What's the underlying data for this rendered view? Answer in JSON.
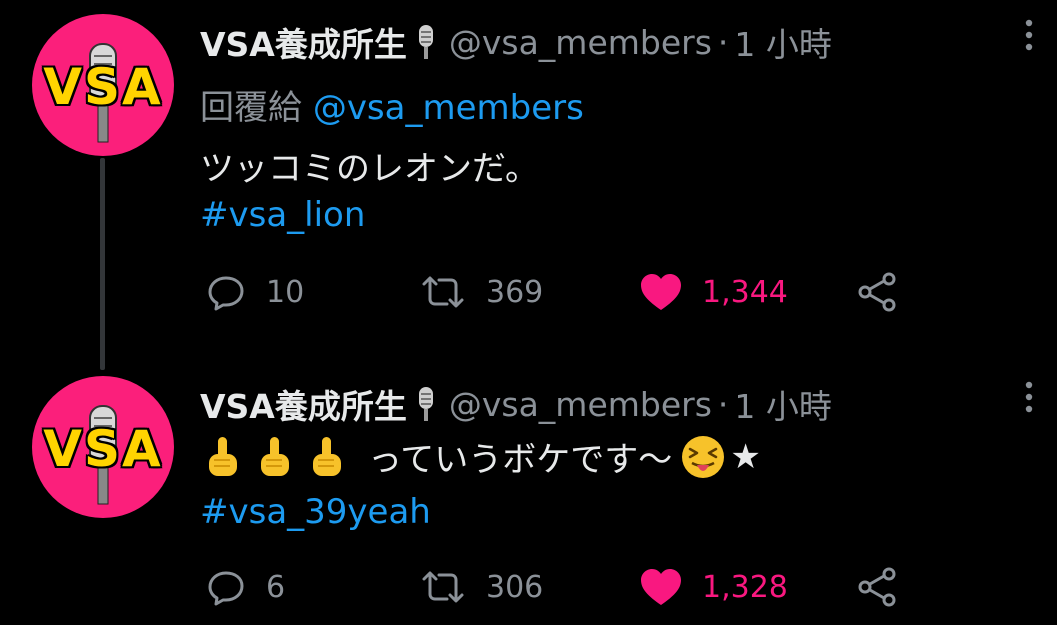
{
  "tweets": [
    {
      "avatar_text": "VSA",
      "name": "VSA養成所生",
      "handle": "@vsa_members",
      "dot": "·",
      "time": "1 小時",
      "reply_prefix": "回覆給",
      "reply_to": "@vsa_members",
      "text": "ツッコミのレオンだ。",
      "hashtag": "#vsa_lion",
      "replies": "10",
      "retweets": "369",
      "likes": "1,344"
    },
    {
      "avatar_text": "VSA",
      "name": "VSA養成所生",
      "handle": "@vsa_members",
      "dot": "·",
      "time": "1 小時",
      "text": "っていうボケです～",
      "star": "★",
      "hashtag": "#vsa_39yeah",
      "replies": "6",
      "retweets": "306",
      "likes": "1,328"
    }
  ],
  "colors": {
    "background": "#000000",
    "link": "#1d9bf0",
    "like": "#f91880",
    "muted": "#8b9198",
    "avatar_bg": "#fb1f7b",
    "avatar_text": "#ffd400"
  },
  "icons": [
    "microphone-icon",
    "more-icon",
    "reply-icon",
    "retweet-icon",
    "heart-icon",
    "share-icon",
    "pointing-up-hand-icon",
    "squinting-tongue-face-icon"
  ]
}
